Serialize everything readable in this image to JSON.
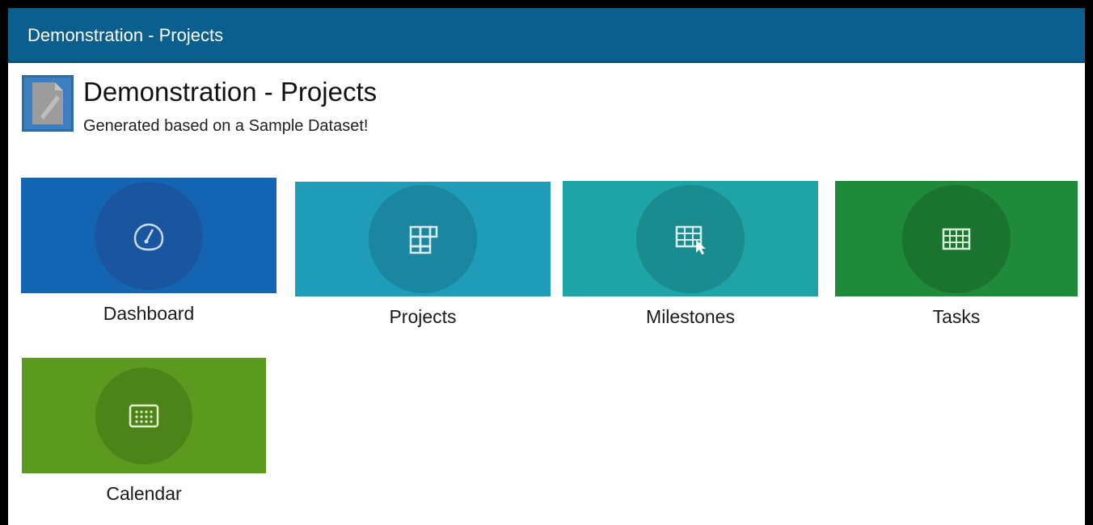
{
  "window": {
    "title": "Demonstration - Projects"
  },
  "app": {
    "title": "Demonstration - Projects",
    "subtitle": "Generated based on a Sample Dataset!",
    "logo_icon": "document-icon",
    "logo_color": "#3b7fc0"
  },
  "tiles": [
    {
      "label": "Dashboard",
      "icon": "gauge-icon",
      "color": "#1464b4",
      "circle": "#1a55a0"
    },
    {
      "label": "Projects",
      "icon": "grid-icon",
      "color": "#1f9cb8",
      "circle": "#1b86a0"
    },
    {
      "label": "Milestones",
      "icon": "grid-pointer-icon",
      "color": "#1ea3a6",
      "circle": "#1a8c8f"
    },
    {
      "label": "Tasks",
      "icon": "table-icon",
      "color": "#1f8a3a",
      "circle": "#1a7430"
    },
    {
      "label": "Calendar",
      "icon": "calendar-icon",
      "color": "#5b9a1f",
      "circle": "#4d8419"
    }
  ]
}
